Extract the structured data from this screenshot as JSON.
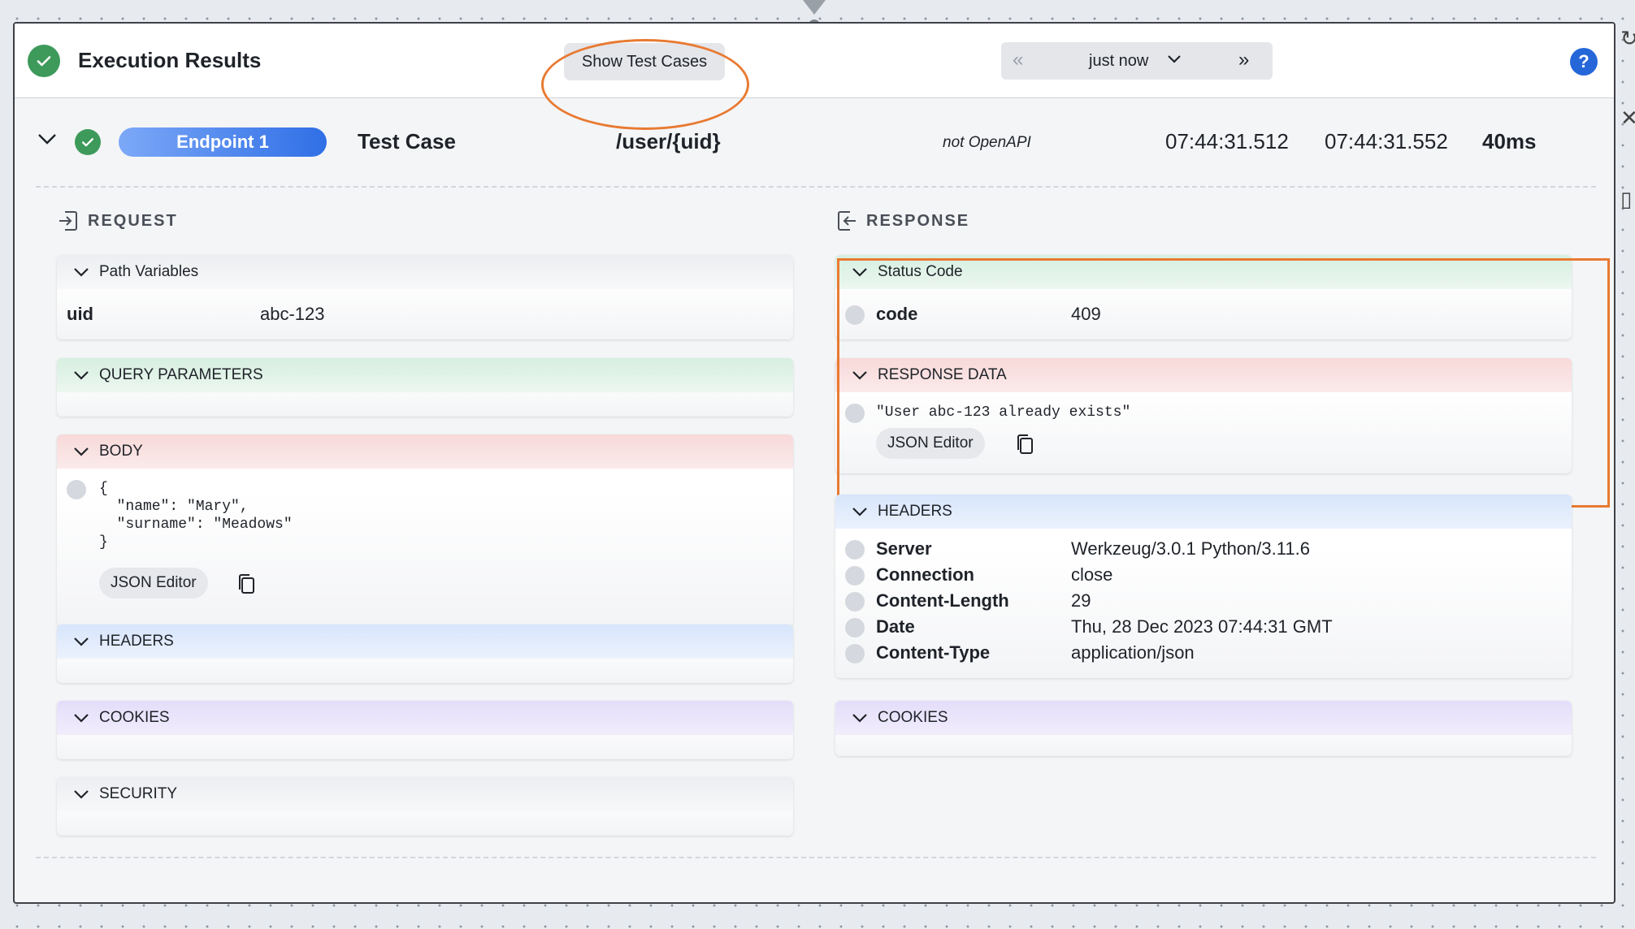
{
  "topbar": {
    "title": "Execution Results",
    "show_test_cases": "Show Test Cases",
    "history_label": "just now",
    "help": "?"
  },
  "endpoint": {
    "name": "Endpoint 1",
    "test_case": "Test Case",
    "path": "/user/{uid}",
    "spec": "not OpenAPI",
    "start_time": "07:44:31.512",
    "end_time": "07:44:31.552",
    "duration": "40ms"
  },
  "request": {
    "heading": "REQUEST",
    "path_variables": {
      "title": "Path Variables",
      "rows": [
        {
          "key": "uid",
          "value": "abc-123"
        }
      ]
    },
    "query_parameters": {
      "title": "QUERY PARAMETERS"
    },
    "body": {
      "title": "BODY",
      "content": "{\n  \"name\": \"Mary\",\n  \"surname\": \"Meadows\"\n}",
      "json_editor": "JSON Editor"
    },
    "headers": {
      "title": "HEADERS"
    },
    "cookies": {
      "title": "COOKIES"
    },
    "security": {
      "title": "SECURITY"
    }
  },
  "response": {
    "heading": "RESPONSE",
    "status_code": {
      "title": "Status Code",
      "key": "code",
      "value": "409"
    },
    "response_data": {
      "title": "RESPONSE DATA",
      "content": "\"User abc-123 already exists\"",
      "json_editor": "JSON Editor"
    },
    "headers": {
      "title": "HEADERS",
      "rows": [
        {
          "key": "Server",
          "value": "Werkzeug/3.0.1 Python/3.11.6"
        },
        {
          "key": "Connection",
          "value": "close"
        },
        {
          "key": "Content-Length",
          "value": "29"
        },
        {
          "key": "Date",
          "value": "Thu, 28 Dec 2023 07:44:31 GMT"
        },
        {
          "key": "Content-Type",
          "value": "application/json"
        }
      ]
    },
    "cookies": {
      "title": "COOKIES"
    }
  },
  "colors": {
    "success": "#3d9a5a",
    "accent": "#2f6fe6",
    "highlight": "#e87a32"
  },
  "icons": [
    "check-circle-icon",
    "chevron-down-icon",
    "double-chevron-left-icon",
    "double-chevron-right-icon",
    "help-icon",
    "login-icon",
    "logout-icon",
    "copy-icon"
  ]
}
